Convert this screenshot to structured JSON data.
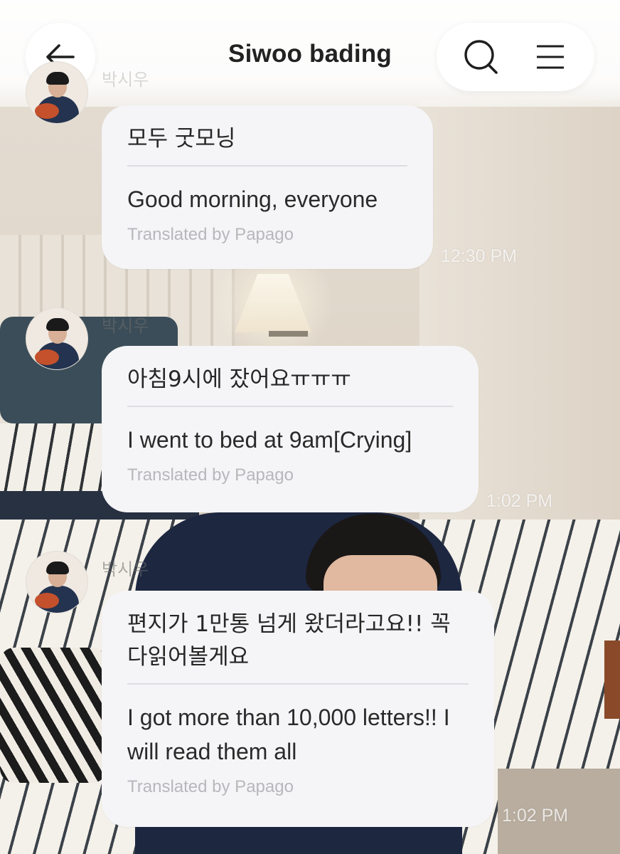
{
  "header": {
    "title": "Siwoo bading",
    "back_icon": "arrow-left-icon",
    "search_icon": "search-icon",
    "menu_icon": "menu-icon"
  },
  "messages": [
    {
      "sender": "박시우",
      "original": "모두 굿모닝",
      "translation": "Good morning, everyone",
      "translated_by": "Translated by Papago",
      "time": "12:30 PM"
    },
    {
      "sender": "박시우",
      "original": "아침9시에 잤어요ㅠㅠㅠ",
      "translation": "I went to bed at 9am[Crying]",
      "translated_by": "Translated by Papago",
      "time": "1:02 PM"
    },
    {
      "sender": "박시우",
      "original": "편지가 1만통 넘게 왔더라고요!! 꼭 다읽어볼게요",
      "translation": "I got more than 10,000 letters!! I will read them all",
      "translated_by": "Translated by Papago",
      "time": "1:02 PM"
    }
  ],
  "colors": {
    "bubble": "#f5f5f7",
    "title": "#222222",
    "translated_by": "#b8b8bc"
  }
}
